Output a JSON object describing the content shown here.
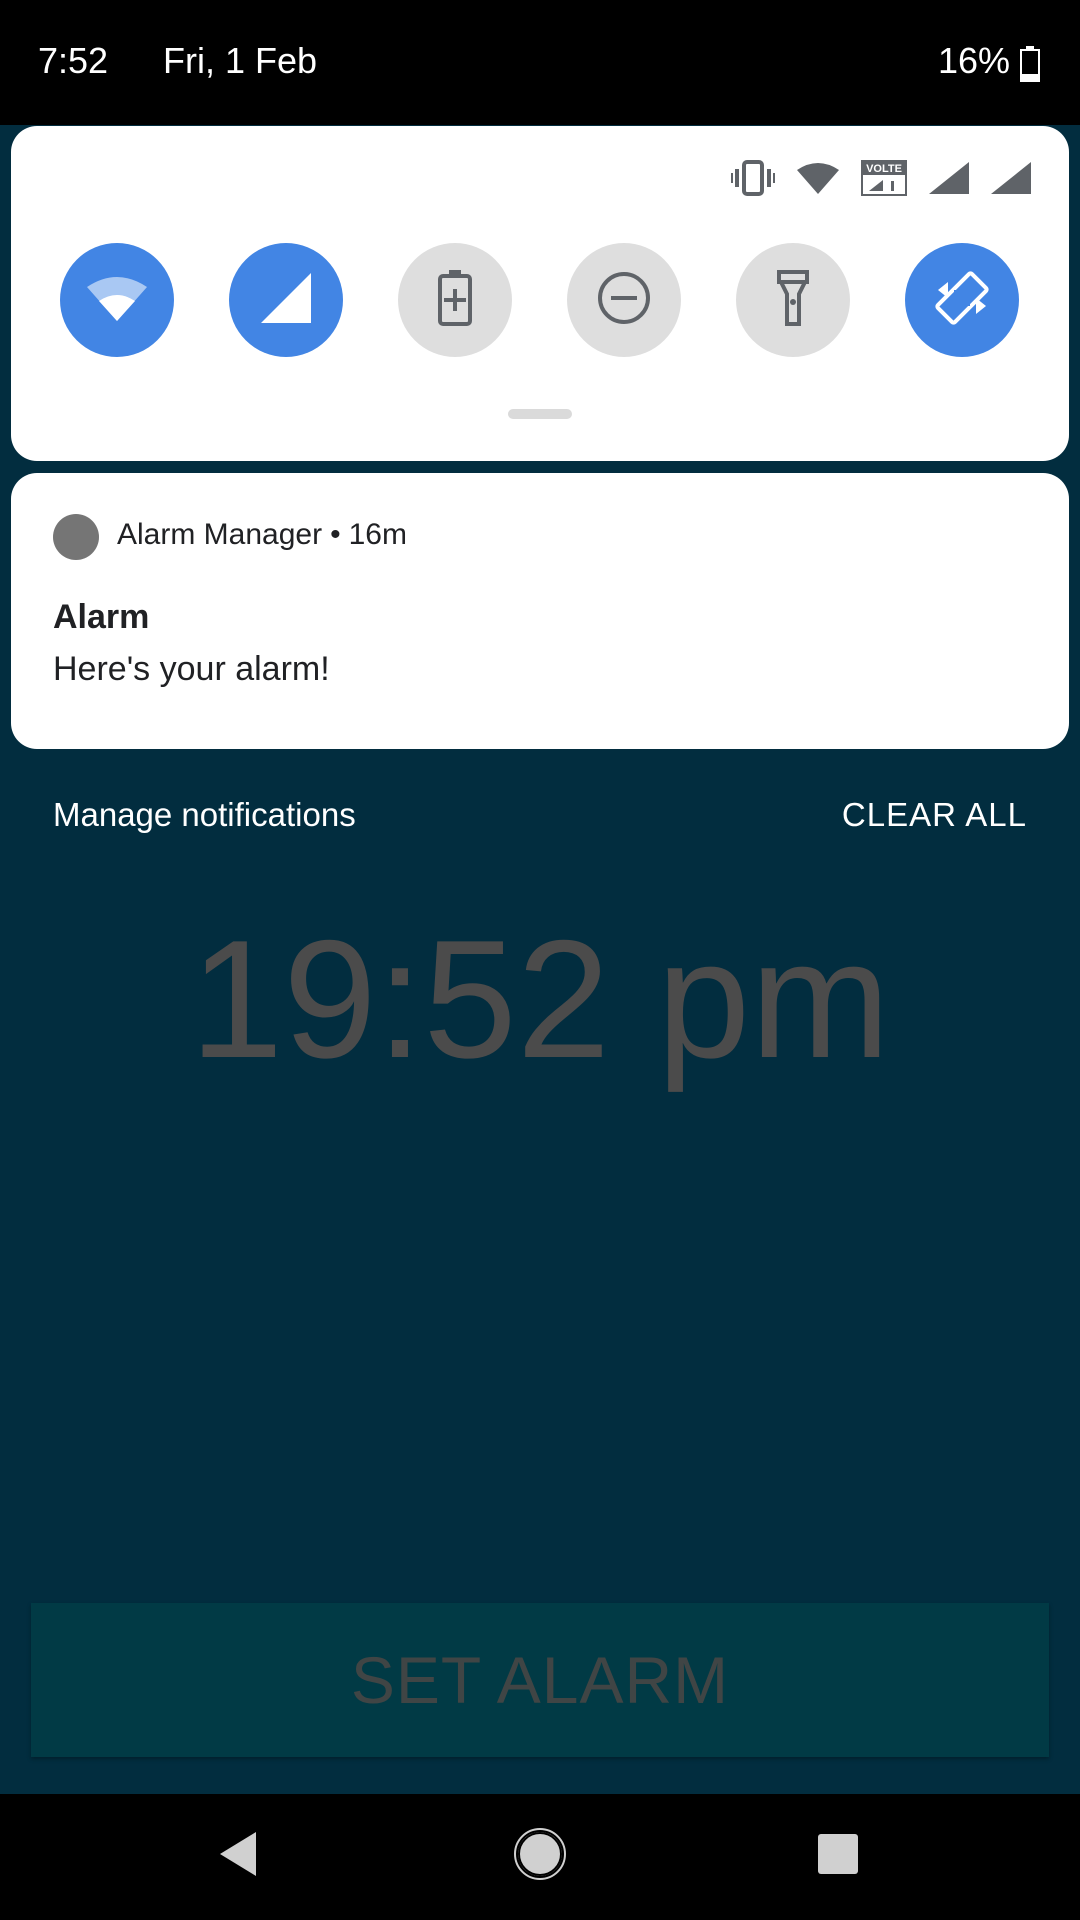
{
  "status_bar": {
    "time": "7:52",
    "date": "Fri, 1 Feb",
    "battery_percent": "16%",
    "icons": [
      "battery-icon"
    ]
  },
  "quick_settings": {
    "status_icons": [
      "vibrate-icon",
      "wifi-icon",
      "volte-icon",
      "signal-icon",
      "signal-icon"
    ],
    "volte_label": "VOLTE",
    "tiles": [
      {
        "icon": "wifi-icon",
        "active": true
      },
      {
        "icon": "mobile-data-icon",
        "active": true
      },
      {
        "icon": "battery-saver-icon",
        "active": false
      },
      {
        "icon": "do-not-disturb-icon",
        "active": false
      },
      {
        "icon": "flashlight-icon",
        "active": false
      },
      {
        "icon": "auto-rotate-icon",
        "active": true
      }
    ],
    "active_color": "#4285e4",
    "inactive_color": "#dedede"
  },
  "notification": {
    "app_name": "Alarm Manager",
    "separator": "•",
    "time_ago": "16m",
    "title": "Alarm",
    "text": "Here's your alarm!"
  },
  "shade_footer": {
    "manage_label": "Manage notifications",
    "clear_all_label": "CLEAR ALL"
  },
  "app": {
    "clock_text": "19:52 pm",
    "set_alarm_label": "SET ALARM",
    "background_color": "#022d3f"
  },
  "nav_bar": {
    "icons": [
      "back-icon",
      "home-icon",
      "recents-icon"
    ]
  }
}
